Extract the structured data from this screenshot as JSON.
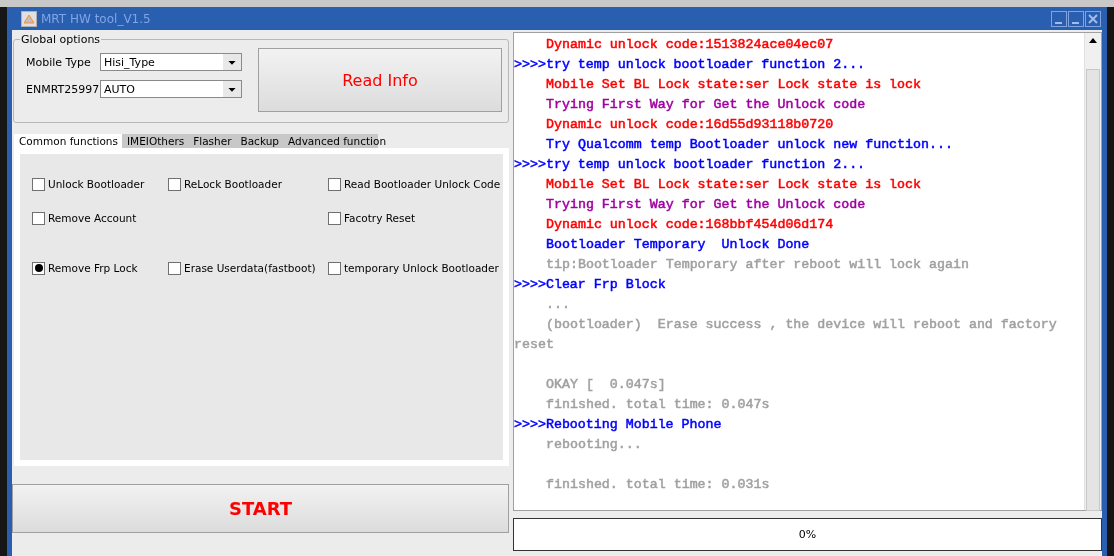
{
  "window": {
    "title": "MRT HW tool_V1.5"
  },
  "global_options": {
    "label": "Global options",
    "fields": [
      {
        "label": "Mobile Type",
        "value": "Hisi_Type"
      },
      {
        "label": "ENMRT25997",
        "value": "AUTO"
      }
    ],
    "read_button": "Read Info"
  },
  "tabs": [
    {
      "label": "Common functions",
      "selected": true
    },
    {
      "label": "IMEIOthers",
      "selected": false
    },
    {
      "label": "Flasher",
      "selected": false
    },
    {
      "label": "Backup",
      "selected": false
    },
    {
      "label": "Advanced function",
      "selected": false
    }
  ],
  "option_rows": [
    {
      "left": {
        "label": "Unlock Bootloader",
        "checked": false
      },
      "middle": {
        "label": "ReLock Bootloader",
        "checked": false
      },
      "right": {
        "label": "Read Bootloader Unlock Code",
        "checked": false
      }
    },
    {
      "left": {
        "label": "Remove Account",
        "checked": false
      },
      "right": {
        "label": "Facotry Reset",
        "checked": false
      }
    },
    {
      "left": {
        "label": "Remove Frp Lock",
        "checked": true
      },
      "middle": {
        "label": "Erase Userdata(fastboot)",
        "checked": false
      },
      "right": {
        "label": "temporary Unlock Bootloader",
        "checked": false
      }
    }
  ],
  "start_button": "START",
  "log": [
    {
      "text": "Dynamic unlock code:1513824ace04ec07",
      "kind": "detail",
      "color": "#ff0000"
    },
    {
      "text": ">>>>try temp unlock bootloader function 2...",
      "kind": "step",
      "color": "#0000ff"
    },
    {
      "text": "Mobile Set BL Lock state:ser Lock state is lock",
      "kind": "detail",
      "color": "#ff0000"
    },
    {
      "text": "Trying First Way for Get the Unlock code",
      "kind": "detail",
      "color": "#a000a0"
    },
    {
      "text": "Dynamic unlock code:16d55d93118b0720",
      "kind": "detail",
      "color": "#ff0000"
    },
    {
      "text": "Try Qualcomm temp Bootloader unlock new function...",
      "kind": "detail",
      "color": "#0000ff"
    },
    {
      "text": ">>>>try temp unlock bootloader function 2...",
      "kind": "step",
      "color": "#0000ff"
    },
    {
      "text": "Mobile Set BL Lock state:ser Lock state is lock",
      "kind": "detail",
      "color": "#ff0000"
    },
    {
      "text": "Trying First Way for Get the Unlock code",
      "kind": "detail",
      "color": "#a000a0"
    },
    {
      "text": "Dynamic unlock code:168bbf454d06d174",
      "kind": "detail",
      "color": "#ff0000"
    },
    {
      "text": "Bootloader Temporary  Unlock Done",
      "kind": "detail",
      "color": "#0000ff"
    },
    {
      "text": "tip:Bootloader Temporary after reboot will lock again",
      "kind": "detail",
      "color": "#a0a0a0"
    },
    {
      "text": ">>>>Clear Frp Block",
      "kind": "step",
      "color": "#0000ff"
    },
    {
      "text": "...",
      "kind": "detail",
      "color": "#a0a0a0"
    },
    {
      "text": "(bootloader)  Erase success , the device will reboot and factory reset",
      "kind": "detail",
      "color": "#a0a0a0"
    },
    {
      "text": "OKAY [  0.047s]",
      "kind": "detail",
      "color": "#a0a0a0",
      "blank_before": true
    },
    {
      "text": "finished. total time: 0.047s",
      "kind": "detail",
      "color": "#a0a0a0"
    },
    {
      "text": ">>>>Rebooting Mobile Phone",
      "kind": "step",
      "color": "#0000ff"
    },
    {
      "text": "rebooting...",
      "kind": "detail",
      "color": "#a0a0a0"
    },
    {
      "text": "finished. total time: 0.031s",
      "kind": "detail",
      "color": "#a0a0a0",
      "blank_before": true
    }
  ],
  "progress": {
    "level": 0,
    "reading": "0%"
  }
}
